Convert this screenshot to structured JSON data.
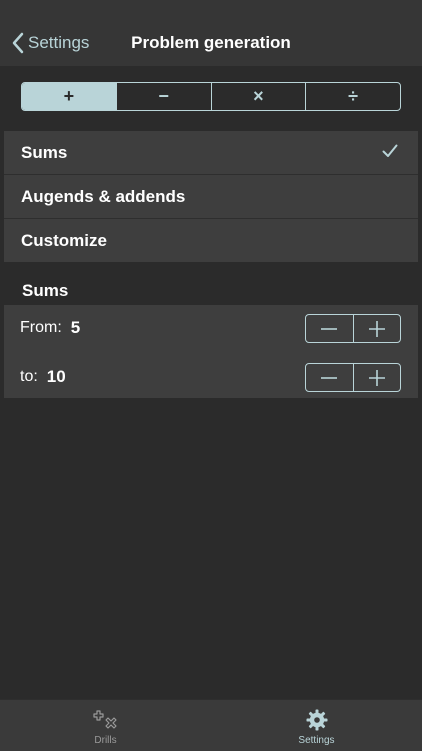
{
  "navbar": {
    "back_label": "Settings",
    "title": "Problem generation"
  },
  "operations": [
    {
      "symbol": "+",
      "selected": true
    },
    {
      "symbol": "−",
      "selected": false
    },
    {
      "symbol": "×",
      "selected": false
    },
    {
      "symbol": "÷",
      "selected": false
    }
  ],
  "mode_list": {
    "items": [
      {
        "label": "Sums",
        "checked": true
      },
      {
        "label": "Augends & addends",
        "checked": false
      },
      {
        "label": "Customize",
        "checked": false
      }
    ]
  },
  "section": {
    "title": "Sums"
  },
  "range": {
    "from": {
      "label": "From:",
      "value": "5"
    },
    "to": {
      "label": "to:",
      "value": "10"
    }
  },
  "tabbar": {
    "tabs": [
      {
        "label": "Drills",
        "icon": "plus-times-icon",
        "active": false
      },
      {
        "label": "Settings",
        "icon": "gear-icon",
        "active": true
      }
    ]
  },
  "colors": {
    "accent": "#b9d4d8",
    "background": "#2b2b2b",
    "cell": "#3e3e3e",
    "navbar": "#363636"
  }
}
